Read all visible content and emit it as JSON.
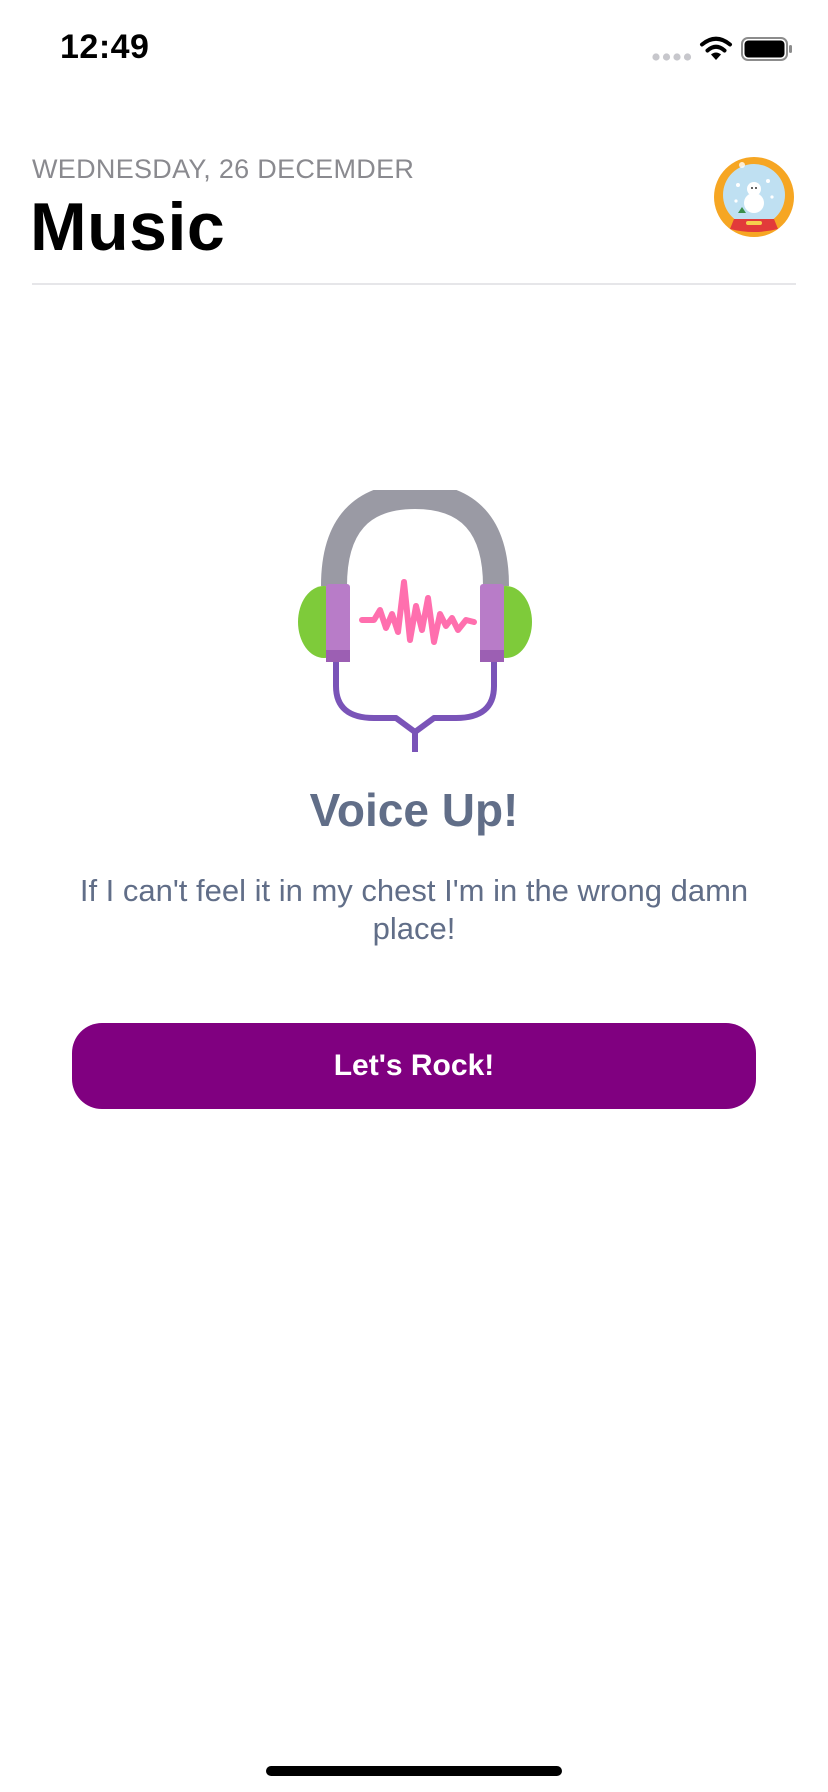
{
  "status_bar": {
    "time": "12:49",
    "icons": [
      "signal-icon",
      "wifi-icon",
      "battery-icon"
    ]
  },
  "header": {
    "date": "WEDNESDAY, 26 DECEMDER",
    "title": "Music",
    "avatar_icon": "snow-globe-avatar"
  },
  "empty_state": {
    "illustration_icon": "headphones-icon",
    "title": "Voice Up!",
    "message": "If I can't feel it in my chest I'm in the wrong damn place!",
    "button_label": "Let's Rock!"
  },
  "colors": {
    "accent": "#800080",
    "text_muted": "#616e88",
    "date_gray": "#8a8a8f",
    "divider": "#e6e6e9"
  }
}
